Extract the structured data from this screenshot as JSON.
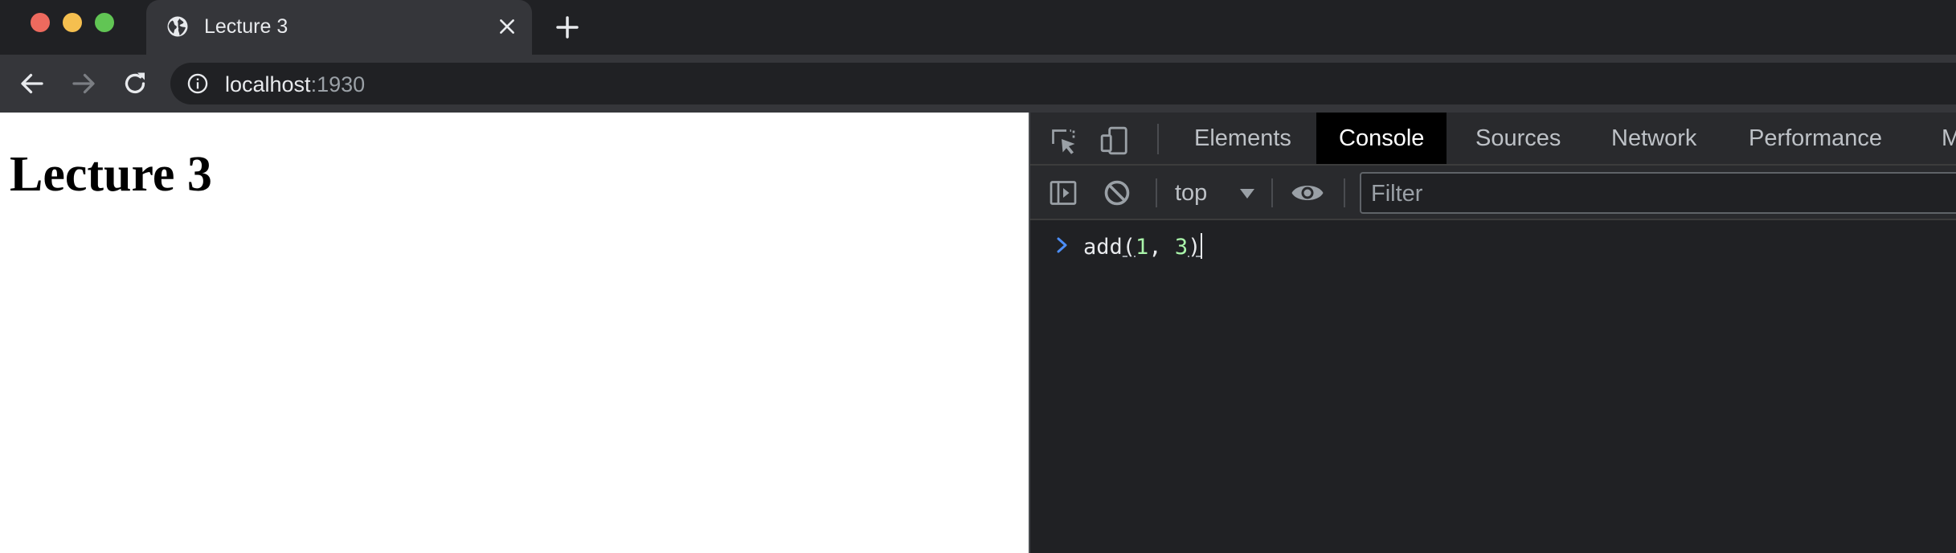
{
  "tab": {
    "title": "Lecture 3",
    "favicon_icon": "globe-icon",
    "close_icon": "close-icon",
    "new_tab_icon": "plus-icon"
  },
  "toolbar": {
    "back_icon": "arrow-back-icon",
    "forward_icon": "arrow-forward-icon",
    "reload_icon": "reload-icon",
    "info_icon": "info-icon",
    "url_host": "localhost",
    "url_port": ":1930"
  },
  "page": {
    "heading": "Lecture 3"
  },
  "devtools": {
    "tabs": [
      {
        "label": "Elements",
        "active": false
      },
      {
        "label": "Console",
        "active": true
      },
      {
        "label": "Sources",
        "active": false
      },
      {
        "label": "Network",
        "active": false
      },
      {
        "label": "Performance",
        "active": false
      },
      {
        "label": "M",
        "active": false
      }
    ],
    "context": "top",
    "filter_placeholder": "Filter",
    "console_input": {
      "fn": "add",
      "open": "(",
      "arg1": "1",
      "comma": ", ",
      "arg2": "3",
      "close": ")"
    }
  },
  "colors": {
    "tabstrip_bg": "#202124",
    "toolbar_bg": "#35363a",
    "devtools_bg": "#202124",
    "active_tab_bg": "#000000",
    "number_token": "#aaf5aa",
    "prompt_chevron": "#4c8ef7"
  }
}
